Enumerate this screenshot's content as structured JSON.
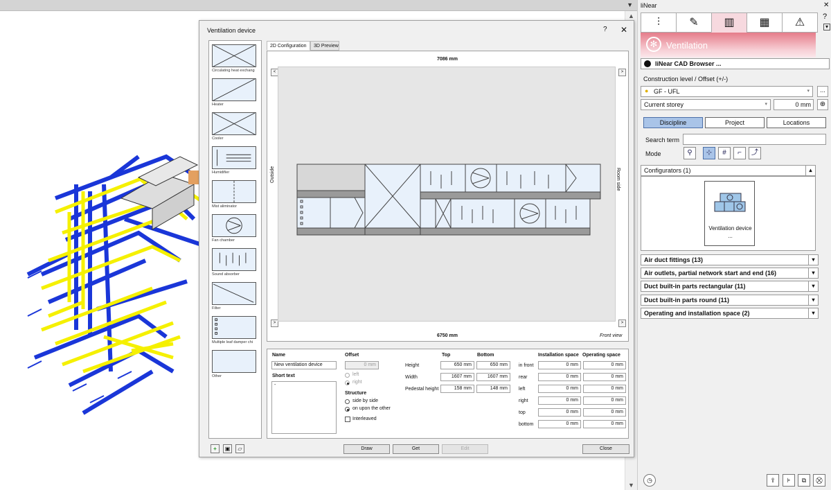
{
  "dialog": {
    "title": "Ventilation device",
    "help": "?",
    "close": "✕",
    "tabs": [
      "2D Configuration",
      "3D Preview"
    ],
    "library": [
      {
        "label": "Circulating heat exchang",
        "icon": "cross-box-icon"
      },
      {
        "label": "Heater",
        "icon": "diagonal-box-icon"
      },
      {
        "label": "Cooler",
        "icon": "cross-box-icon"
      },
      {
        "label": "Humidifier",
        "icon": "humidifier-icon"
      },
      {
        "label": "Mist aliminator",
        "icon": "mist-eliminator-icon"
      },
      {
        "label": "Fan chamber",
        "icon": "fan-icon"
      },
      {
        "label": "Sound absorber",
        "icon": "sound-absorber-icon"
      },
      {
        "label": "Filter",
        "icon": "filter-icon"
      },
      {
        "label": "Multiple leaf damper chi",
        "icon": "damper-icon"
      },
      {
        "label": "Other",
        "icon": "blank-box-icon"
      }
    ],
    "view": {
      "top_dim": "7086 mm",
      "bottom_dim": "6750 mm",
      "left_side": "Outside",
      "right_side": "Room side",
      "view_name": "Front view",
      "nav_left": "<",
      "nav_right": ">"
    },
    "props": {
      "name_label": "Name",
      "name_value": "New ventilation device",
      "short_text_label": "Short text",
      "short_text_value": "-",
      "offset_label": "Offset",
      "offset_value": "0 mm",
      "offset_left": "left",
      "offset_right": "right",
      "structure_label": "Structure",
      "structure_side": "side by side",
      "structure_upon": "on upon the other",
      "interleaved": "Interleaved",
      "col_top": "Top",
      "col_bottom": "Bottom",
      "rows": [
        {
          "label": "Height",
          "top": "650 mm",
          "bottom": "650 mm"
        },
        {
          "label": "Width",
          "top": "1607 mm",
          "bottom": "1607 mm"
        },
        {
          "label": "Pedestal height",
          "top": "158 mm",
          "bottom": "148 mm"
        }
      ],
      "col_install": "Installation space",
      "col_operating": "Operating space",
      "space_rows": [
        {
          "label": "in front",
          "install": "0 mm",
          "operating": "0 mm"
        },
        {
          "label": "rear",
          "install": "0 mm",
          "operating": "0 mm"
        },
        {
          "label": "left",
          "install": "0 mm",
          "operating": "0 mm"
        },
        {
          "label": "right",
          "install": "0 mm",
          "operating": "0 mm"
        },
        {
          "label": "top",
          "install": "0 mm",
          "operating": "0 mm"
        },
        {
          "label": "bottom",
          "install": "0 mm",
          "operating": "0 mm"
        }
      ]
    },
    "buttons": {
      "draw": "Draw",
      "get": "Get",
      "edit": "Edit",
      "close": "Close"
    },
    "small_icons": [
      "add-icon",
      "save-icon",
      "open-icon"
    ]
  },
  "panel": {
    "title": "liNear",
    "close": "✕",
    "discipline": "Ventilation",
    "browser_button": "liNear CAD Browser ...",
    "construction_label": "Construction level / Offset (+/-)",
    "construction_value": "GF - UFL",
    "storey_value": "Current storey",
    "offset_value": "0 mm",
    "segments": [
      "Discipline",
      "Project",
      "Locations"
    ],
    "search_label": "Search term",
    "search_value": "",
    "mode_label": "Mode",
    "configurators_label": "Configurators (1)",
    "configurator_tile": "Ventilation device ...",
    "categories": [
      "Air duct fittings (13)",
      "Air outlets, partial network start and end (16)",
      "Duct built-in parts rectangular (11)",
      "Duct built-in parts round (11)",
      "Operating and installation space (2)"
    ],
    "accent": "#e57c8a"
  }
}
